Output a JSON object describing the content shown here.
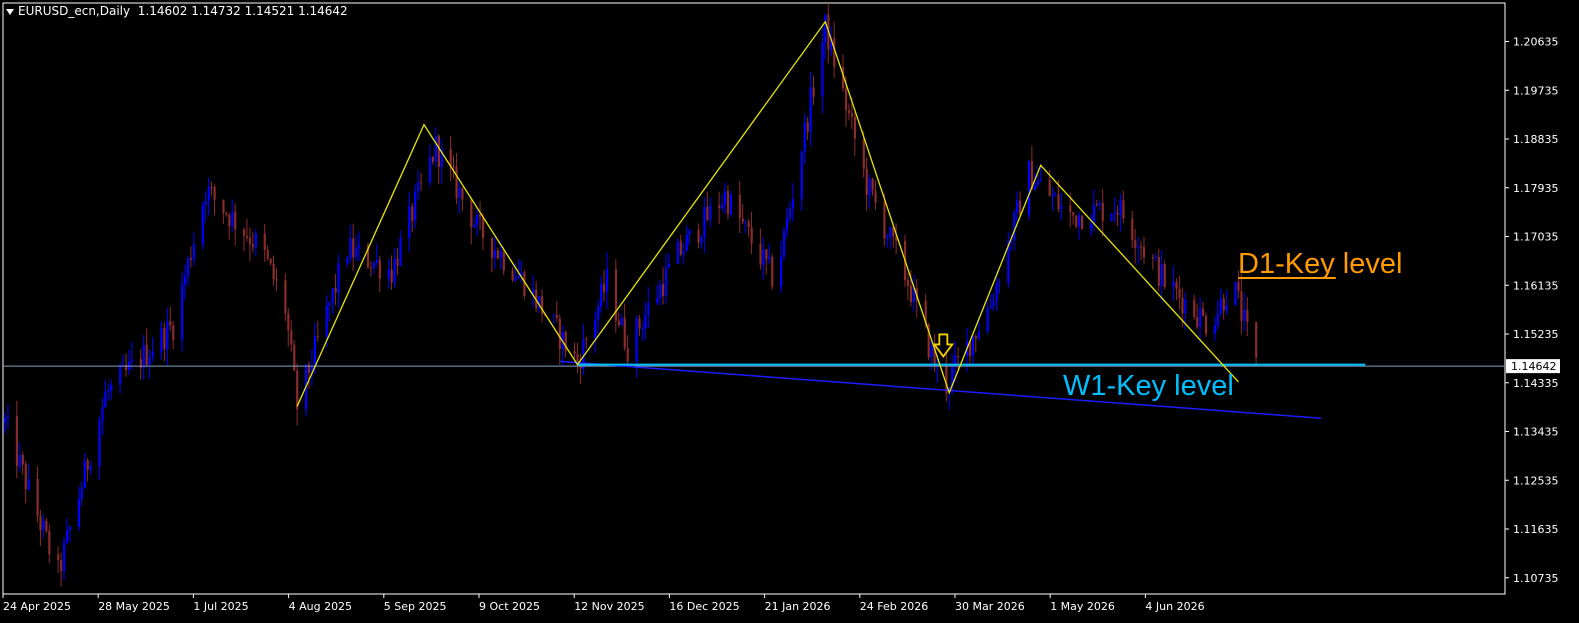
{
  "header": {
    "symbol_tf": "EURUSD_ecn,Daily",
    "ohlc": "1.14602 1.14732 1.14521 1.14642"
  },
  "colors": {
    "background": "#000000",
    "frame": "#ffffff",
    "bull": "#0000ff",
    "bear": "#8b2c2c",
    "zigzag": "#e6e600",
    "w1_line": "#00bfff",
    "trendline": "#1c1cff",
    "d1_line": "#ff9a00",
    "price_line": "#7f9fbf",
    "arrow": "#f5d000"
  },
  "chart_data": {
    "type": "candlestick",
    "title": "EURUSD_ecn,Daily",
    "ylim": [
      1.1048,
      1.2115
    ],
    "y_ticks": [
      "1.20635",
      "1.19735",
      "1.18835",
      "1.17935",
      "1.17035",
      "1.16135",
      "1.15235",
      "1.14335",
      "1.13435",
      "1.12535",
      "1.11635",
      "1.10735"
    ],
    "x_ticks": [
      "24 Apr 2025",
      "28 May 2025",
      "1 Jul 2025",
      "4 Aug 2025",
      "5 Sep 2025",
      "9 Oct 2025",
      "12 Nov 2025",
      "16 Dec 2025",
      "21 Jan 2026",
      "24 Feb 2026",
      "30 Mar 2026",
      "1 May 2026",
      "4 Jun 2026"
    ],
    "current_price": "1.14642",
    "path_points": [
      {
        "date": "2025-04-24",
        "price": 1.136
      },
      {
        "date": "2025-05-12",
        "price": 1.108
      },
      {
        "date": "2025-05-28",
        "price": 1.141
      },
      {
        "date": "2025-06-20",
        "price": 1.154
      },
      {
        "date": "2025-07-01",
        "price": 1.179
      },
      {
        "date": "2025-07-20",
        "price": 1.168
      },
      {
        "date": "2025-07-28",
        "price": 1.157
      },
      {
        "date": "2025-08-01",
        "price": 1.139
      },
      {
        "date": "2025-08-18",
        "price": 1.168
      },
      {
        "date": "2025-09-02",
        "price": 1.164
      },
      {
        "date": "2025-09-17",
        "price": 1.187
      },
      {
        "date": "2025-10-01",
        "price": 1.172
      },
      {
        "date": "2025-10-17",
        "price": 1.162
      },
      {
        "date": "2025-11-04",
        "price": 1.147
      },
      {
        "date": "2025-11-14",
        "price": 1.162
      },
      {
        "date": "2025-11-21",
        "price": 1.15
      },
      {
        "date": "2025-12-08",
        "price": 1.167
      },
      {
        "date": "2025-12-24",
        "price": 1.178
      },
      {
        "date": "2026-01-10",
        "price": 1.162
      },
      {
        "date": "2026-01-27",
        "price": 1.209
      },
      {
        "date": "2026-02-10",
        "price": 1.18
      },
      {
        "date": "2026-02-24",
        "price": 1.162
      },
      {
        "date": "2026-03-08",
        "price": 1.142
      },
      {
        "date": "2026-03-24",
        "price": 1.158
      },
      {
        "date": "2026-04-06",
        "price": 1.182
      },
      {
        "date": "2026-04-20",
        "price": 1.174
      },
      {
        "date": "2026-05-06",
        "price": 1.176
      },
      {
        "date": "2026-05-22",
        "price": 1.162
      },
      {
        "date": "2026-06-06",
        "price": 1.154
      },
      {
        "date": "2026-06-14",
        "price": 1.162
      },
      {
        "date": "2026-06-22",
        "price": 1.1464
      }
    ],
    "zigzag": [
      {
        "date": "2025-08-01",
        "price": 1.139
      },
      {
        "date": "2025-09-13",
        "price": 1.191
      },
      {
        "date": "2025-11-04",
        "price": 1.1467
      },
      {
        "date": "2026-01-27",
        "price": 1.21
      },
      {
        "date": "2026-03-10",
        "price": 1.1415
      },
      {
        "date": "2026-04-10",
        "price": 1.1835
      },
      {
        "date": "2026-06-16",
        "price": 1.1435
      }
    ],
    "w1_key_level": {
      "price": 1.1467,
      "from": "2025-11-04",
      "to": "2026-07-29"
    },
    "d1_key_level": {
      "price": 1.1627,
      "from": "2026-06-16",
      "to": "2026-07-19"
    },
    "trendline": {
      "from": {
        "date": "2025-10-29",
        "price": 1.1473
      },
      "to": {
        "date": "2026-07-14",
        "price": 1.1368
      }
    },
    "signal_arrow": {
      "date": "2026-03-08",
      "price": 1.1495
    },
    "annotations": [
      "D1-Key level",
      "W1-Key level"
    ]
  }
}
